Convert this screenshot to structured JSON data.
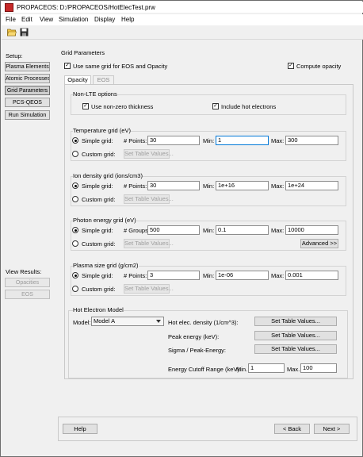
{
  "window": {
    "title": "PROPACEOS:  D:/PROPACEOS/HotElecTest.prw"
  },
  "menu": [
    "File",
    "Edit",
    "View",
    "Simulation",
    "Display",
    "Help"
  ],
  "sidebar": {
    "setup_label": "Setup:",
    "items": [
      "Plasma Elements",
      "Atomic Processes",
      "Grid Parameters",
      "PCS-QEOS",
      "Run Simulation"
    ],
    "results_label": "View Results:",
    "results_items": [
      "Opacities",
      "EOS"
    ]
  },
  "section_title": "Grid Parameters",
  "same_grid_label": "Use same grid for EOS and Opacity",
  "compute_opacity_label": "Compute opacity",
  "tabs": [
    "Opacity",
    "EOS"
  ],
  "nonlte": {
    "title": "Non-LTE options",
    "nonzero_label": "Use non-zero thickness",
    "hot_label": "Include hot electrons"
  },
  "common": {
    "simple": "Simple grid:",
    "custom": "Custom grid:",
    "set_table": "Set Table Values...",
    "min": "Min:",
    "max": "Max:"
  },
  "grids": [
    {
      "title": "Temperature grid (eV)",
      "count_label": "# Points:",
      "count": "30",
      "min": "1",
      "max": "300"
    },
    {
      "title": "Ion density grid (ions/cm3)",
      "count_label": "# Points:",
      "count": "30",
      "min": "1e+16",
      "max": "1e+24"
    },
    {
      "title": "Photon energy grid (eV)",
      "count_label": "# Groups:",
      "count": "500",
      "min": "0.1",
      "max": "10000"
    },
    {
      "title": "Plasma size grid (g/cm2)",
      "count_label": "# Points:",
      "count": "3",
      "min": "1e-06",
      "max": "0.001"
    }
  ],
  "advanced_label": "Advanced >>",
  "hot": {
    "title": "Hot Electron Model",
    "model_label": "Model:",
    "model_value": "Model A",
    "density_label": "Hot elec. density (1/cm^3):",
    "peak_label": "Peak energy (keV):",
    "sigma_label": "Sigma / Peak-Energy:",
    "cutoff_label": "Energy Cutoff Range (keV):",
    "cutoff_min_label": "Min.",
    "cutoff_min": "1",
    "cutoff_max_label": "Max.",
    "cutoff_max": "100"
  },
  "footer": {
    "help": "Help",
    "back": "< Back",
    "next": "Next >"
  }
}
